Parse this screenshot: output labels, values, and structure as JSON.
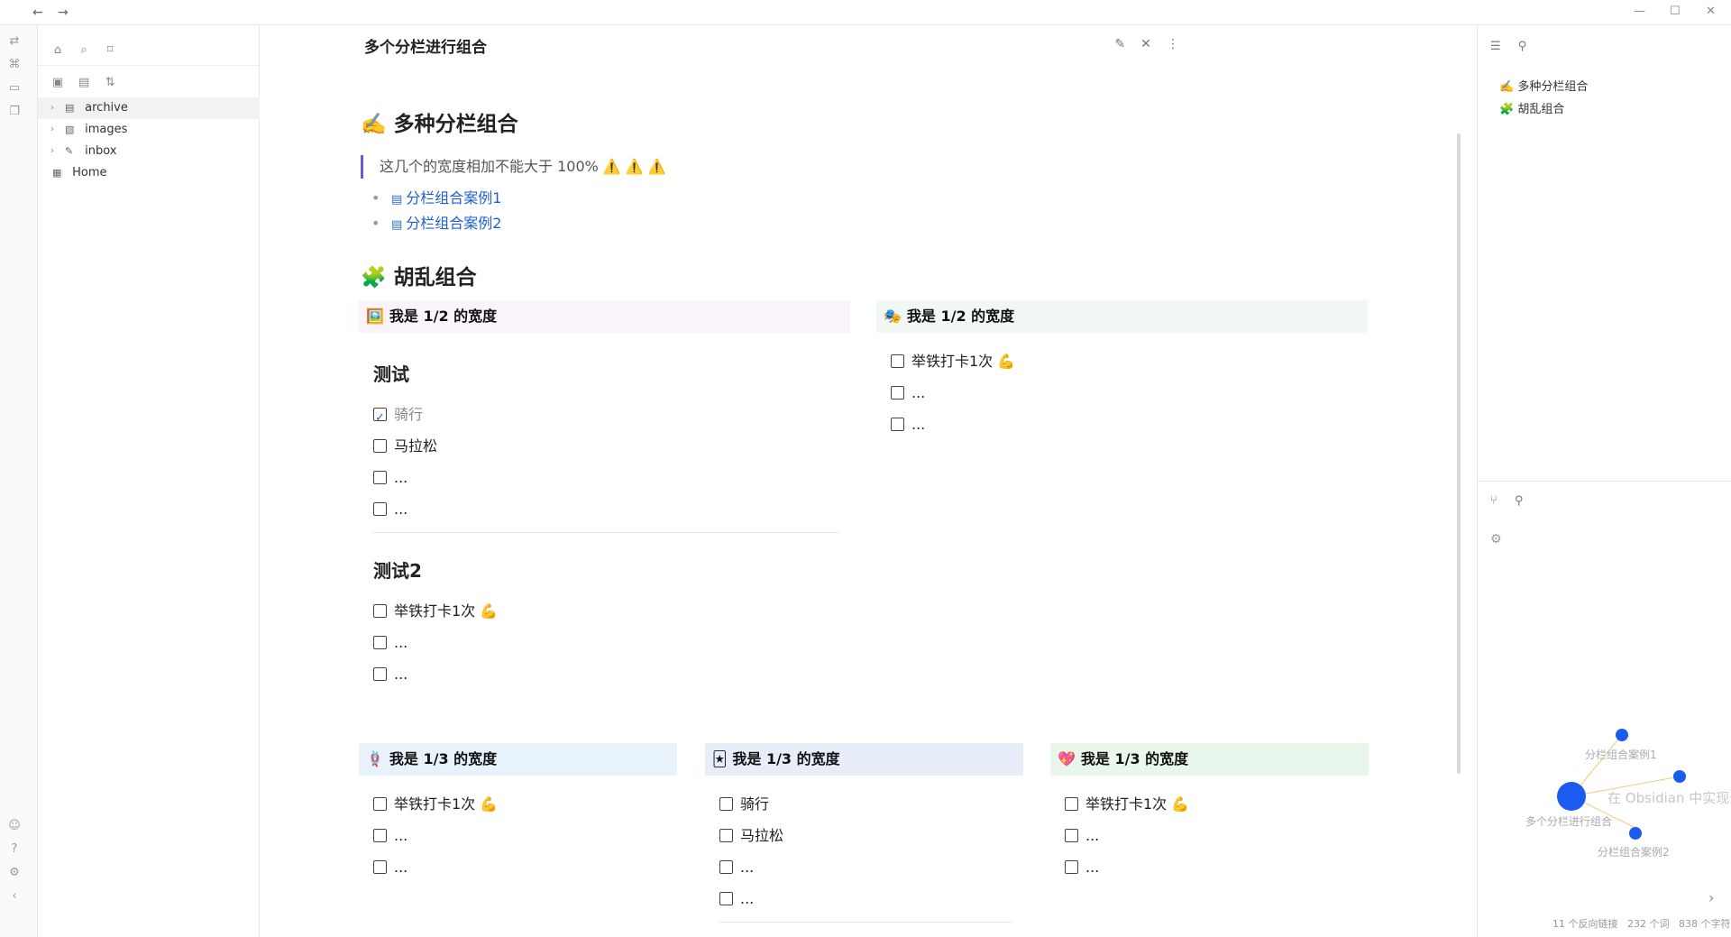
{
  "window": {
    "back_icon": "←",
    "forward_icon": "→",
    "minimize_icon": "—",
    "maximize_icon": "☐",
    "close_icon": "✕"
  },
  "sidebar": {
    "tree": [
      {
        "label": "archive",
        "icon": "▤",
        "expandable": true
      },
      {
        "label": "images",
        "icon": "▧",
        "expandable": true
      },
      {
        "label": "inbox",
        "icon": "✎",
        "expandable": true
      },
      {
        "label": "Home",
        "icon": "▦",
        "expandable": false
      }
    ]
  },
  "main": {
    "title": "多个分栏进行组合",
    "section1": {
      "heading": "✍️ 多种分栏组合",
      "quote": "这几个的宽度相加不能大于 100% ⚠️ ⚠️ ⚠️",
      "links": [
        "分栏组合案例1",
        "分栏组合案例2"
      ]
    },
    "section2": {
      "heading": "🧩 胡乱组合"
    },
    "row1": [
      {
        "title": "我是 1/2 的宽度",
        "emoji": "🖼️",
        "color": "#fbf3fb",
        "groups": [
          {
            "title": "测试",
            "tasks": [
              {
                "text": "骑行",
                "done": true
              },
              {
                "text": "马拉松",
                "done": false
              },
              {
                "text": "...",
                "done": false
              },
              {
                "text": "...",
                "done": false
              }
            ]
          },
          {
            "title": "测试2",
            "tasks": [
              {
                "text": "举铁打卡1次 💪",
                "done": false
              },
              {
                "text": "...",
                "done": false
              },
              {
                "text": "...",
                "done": false
              }
            ]
          }
        ]
      },
      {
        "title": "我是 1/2 的宽度",
        "emoji": "🎭",
        "color": "#f1f8f3",
        "tasks": [
          {
            "text": "举铁打卡1次 💪",
            "done": false
          },
          {
            "text": "...",
            "done": false
          },
          {
            "text": "...",
            "done": false
          }
        ]
      }
    ],
    "row2": [
      {
        "title": "我是 1/3 的宽度",
        "emoji": "🪢",
        "color": "#e7f2fb",
        "tasks": [
          {
            "text": "举铁打卡1次 💪",
            "done": false
          },
          {
            "text": "...",
            "done": false
          },
          {
            "text": "...",
            "done": false
          }
        ]
      },
      {
        "title": "我是 1/3 的宽度",
        "emoji": "🃏",
        "color": "#e8edfa",
        "tasks": [
          {
            "text": "骑行",
            "done": false
          },
          {
            "text": "马拉松",
            "done": false
          },
          {
            "text": "...",
            "done": false
          },
          {
            "text": "...",
            "done": false
          }
        ]
      },
      {
        "title": "我是 1/3 的宽度",
        "emoji": "💖",
        "color": "#e9f6ec",
        "tasks": [
          {
            "text": "举铁打卡1次 💪",
            "done": false
          },
          {
            "text": "...",
            "done": false
          },
          {
            "text": "...",
            "done": false
          }
        ]
      }
    ]
  },
  "right_panel": {
    "outline": [
      "✍️ 多种分栏组合",
      "🧩 胡乱组合"
    ],
    "graph": {
      "nodes": [
        {
          "label": "分栏组合案例1"
        },
        {
          "label": "在 Obsidian 中实现分"
        },
        {
          "label": "多个分栏进行组合"
        },
        {
          "label": "分栏组合案例2"
        }
      ]
    }
  },
  "status_bar": {
    "backlinks": "11 个反向链接",
    "words": "232 个词",
    "chars": "838 个字符"
  },
  "colors": {
    "accent": "#1f5fd1",
    "graph_node": "#1a5cf0",
    "graph_edge": "#f5c87a"
  }
}
